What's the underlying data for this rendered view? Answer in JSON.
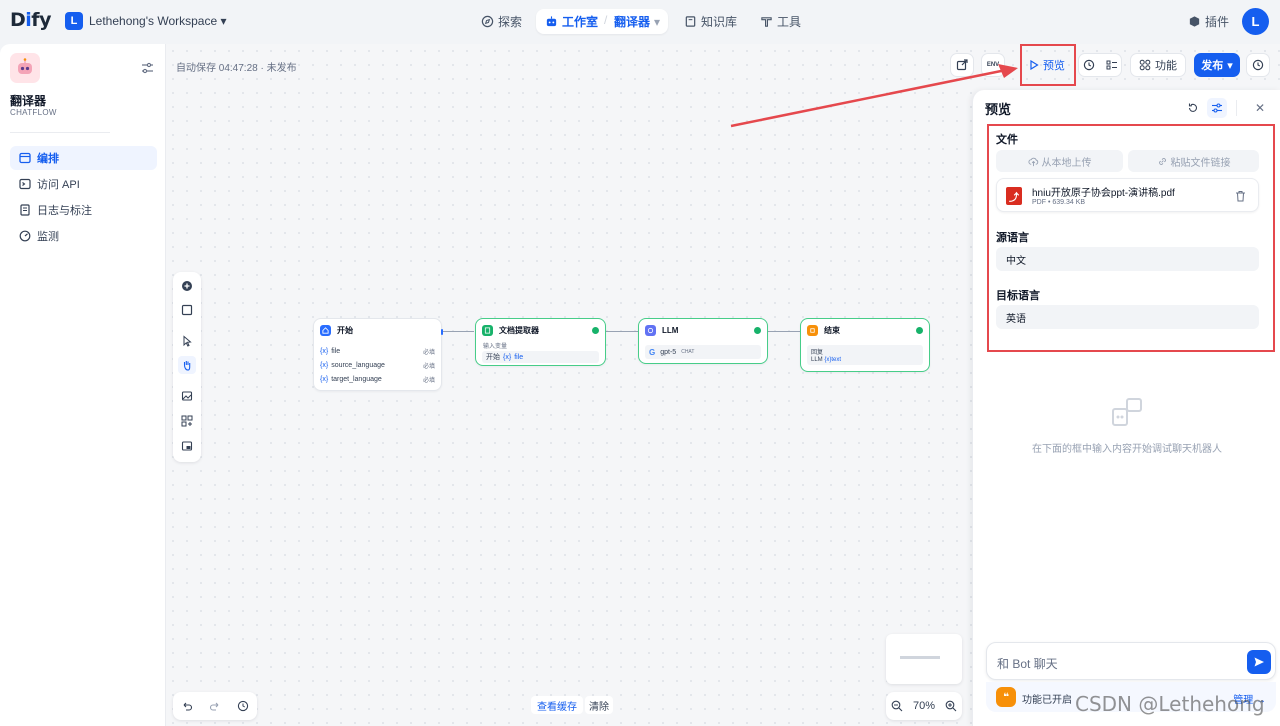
{
  "header": {
    "logo_prefix": "D",
    "logo_accent": "i",
    "logo_suffix": "fy",
    "workspace_initial": "L",
    "workspace_name": "Lethehong's Workspace",
    "nav": {
      "explore": "探索",
      "studio": "工作室",
      "current_app": "翻译器",
      "knowledge": "知识库",
      "tools": "工具"
    },
    "plugins": "插件",
    "user_initial": "L"
  },
  "sidebar": {
    "app_name": "翻译器",
    "app_type": "CHATFLOW",
    "items": [
      {
        "label": "编排",
        "active": true
      },
      {
        "label": "访问 API"
      },
      {
        "label": "日志与标注"
      },
      {
        "label": "监测"
      }
    ]
  },
  "toolbar": {
    "autosave": "自动保存 04:47:28 · 未发布",
    "env": "ENV",
    "preview": "预览",
    "features": "功能",
    "publish": "发布"
  },
  "workflow": {
    "start": {
      "title": "开始",
      "vars": [
        {
          "name": "file",
          "req": "必填"
        },
        {
          "name": "source_language",
          "req": "必填"
        },
        {
          "name": "target_language",
          "req": "必填"
        }
      ]
    },
    "extractor": {
      "title": "文档提取器",
      "sub": "输入变量",
      "src": "开始",
      "var": "file"
    },
    "llm": {
      "title": "LLM",
      "model": "gpt-5",
      "mode": "CHAT"
    },
    "end": {
      "title": "结束",
      "sub": "回复",
      "src": "LLM",
      "var": "text"
    },
    "var_prefix": "{x}"
  },
  "bottom": {
    "view_cache": "查看缓存",
    "clear": "清除",
    "zoom": "70%"
  },
  "preview": {
    "title": "预览",
    "file_label": "文件",
    "upload_local": "从本地上传",
    "paste_link": "粘贴文件链接",
    "file_name": "hniu开放原子协会ppt-演讲稿.pdf",
    "file_meta": "PDF • 639.34 KB",
    "source_label": "源语言",
    "source_value": "中文",
    "target_label": "目标语言",
    "target_value": "英语",
    "empty_hint": "在下面的框中输入内容开始调试聊天机器人",
    "chat_placeholder": "和 Bot 聊天",
    "features_on": "功能已开启",
    "manage": "管理"
  },
  "watermark": "CSDN @Lethehong",
  "colors": {
    "accent": "#155eef",
    "success": "#17b26a",
    "annotation": "#e5484d"
  }
}
